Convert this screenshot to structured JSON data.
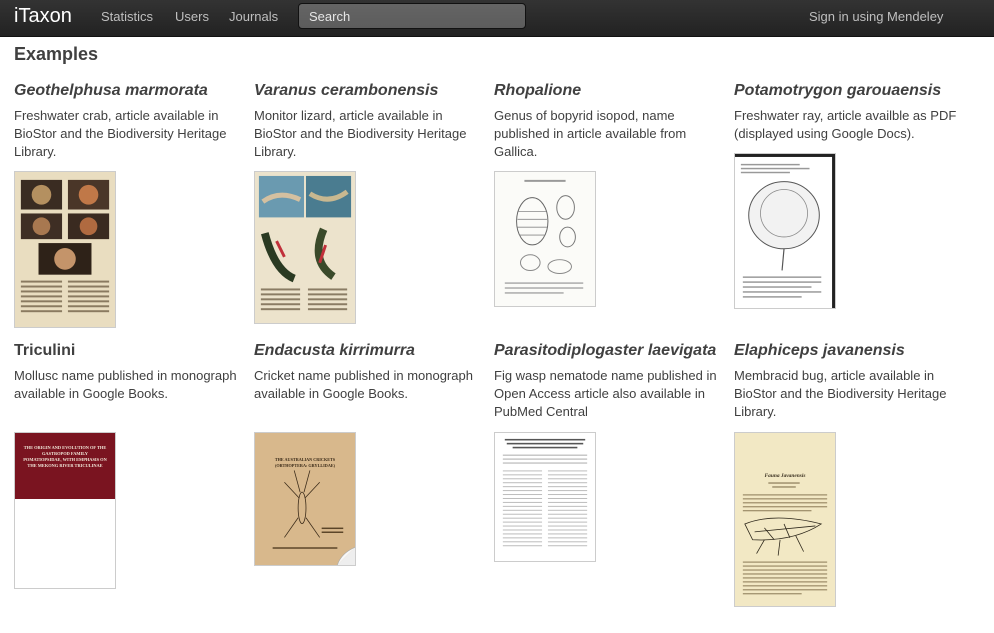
{
  "navbar": {
    "brand": "iTaxon",
    "items": [
      "Statistics",
      "Users",
      "Journals"
    ],
    "search_placeholder": "Search",
    "signin": "Sign in using Mendeley"
  },
  "page_title": "Examples",
  "examples": [
    {
      "title": "Geothelphusa marmorata",
      "desc": "Freshwater crab, article available in BioStor and the Biodiversity Heritage Library."
    },
    {
      "title": "Varanus cerambonensis",
      "desc": "Monitor lizard, article available in BioStor and the Biodiversity Heritage Library."
    },
    {
      "title": "Rhopalione",
      "desc": "Genus of bopyrid isopod, name published in article available from Gallica."
    },
    {
      "title": "Potamotrygon garouaensis",
      "desc": "Freshwater ray, article availble as PDF (displayed using Google Docs)."
    },
    {
      "title": "Triculini",
      "desc": "Mollusc name published in monograph available in Google Books."
    },
    {
      "title": "Endacusta kirrimurra",
      "desc": "Cricket name published in monograph available in Google Books."
    },
    {
      "title": "Parasitodiplogaster laevigata",
      "desc": "Fig wasp nematode name published in Open Access article also available in PubMed Central"
    },
    {
      "title": "Elaphiceps javanensis",
      "desc": "Membracid bug, article available in BioStor and the Biodiversity Heritage Library."
    }
  ],
  "book_covers": {
    "triculini": "THE ORIGIN AND EVOLUTION OF THE GASTROPOD FAMILY POMATIOPSIDAE, WITH EMPHASIS ON THE MEKONG RIVER TRICULINAE",
    "endacusta": "THE AUSTRALIAN CRICKETS (ORTHOPTERA: GRYLLIDAE)",
    "elaphiceps": "Fauna Javanensis"
  }
}
